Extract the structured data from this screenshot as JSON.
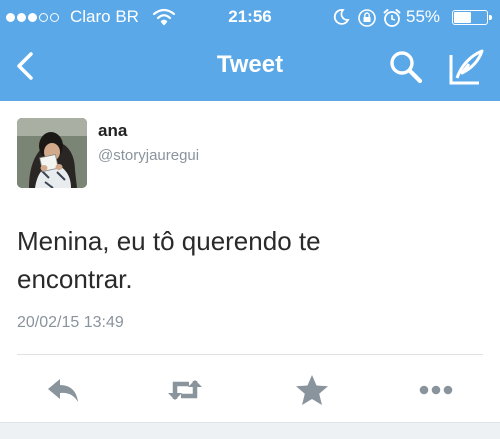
{
  "status_bar": {
    "carrier": "Claro BR",
    "time": "21:56",
    "battery_percent": "55%",
    "battery_level": 0.55,
    "signal_bars_filled": 3,
    "signal_bars_total": 5
  },
  "nav": {
    "title": "Tweet"
  },
  "tweet": {
    "author_name": "ana",
    "author_handle": "@storyjauregui",
    "text": "Menina, eu tô querendo te encontrar.",
    "timestamp": "20/02/15 13:49"
  },
  "colors": {
    "header_bg": "#5aa8e8",
    "action_icon": "#8a949d",
    "secondary_text": "#8a949d"
  },
  "icons": [
    "back-icon",
    "search-icon",
    "compose-icon",
    "reply-icon",
    "retweet-icon",
    "favorite-icon",
    "more-icon",
    "wifi-icon",
    "moon-icon",
    "orientation-lock-icon",
    "alarm-icon",
    "battery-icon"
  ]
}
